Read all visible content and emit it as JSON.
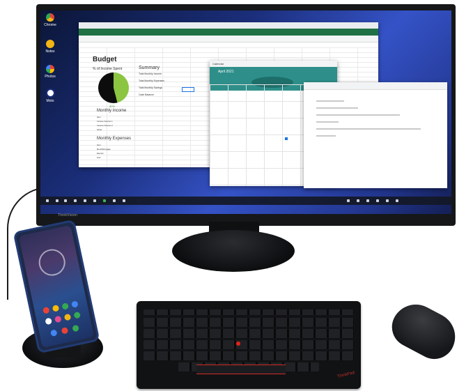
{
  "monitor": {
    "brand": "ThinkVision",
    "desktop_icons": [
      {
        "label": "Chrome",
        "color": "#e0453a"
      },
      {
        "label": "Notes",
        "color": "#f1b514"
      },
      {
        "label": "Photos",
        "color": "#ffffff"
      },
      {
        "label": "Moto",
        "color": "#1b2e7a"
      }
    ],
    "sheets": {
      "title": "Budget",
      "pie_label": "% of Income Spent",
      "pie_percent": "80%",
      "summary_title": "Summary",
      "summary_lines": [
        "Total Monthly Income",
        "Total Monthly Expenses",
        "Total Monthly Savings",
        "Cash Balance"
      ],
      "income_title": "Monthly Income",
      "income_rows": [
        "Item",
        "Income Source 1",
        "Income Source 2",
        "Other"
      ],
      "expenses_title": "Monthly Expenses",
      "expense_rows": [
        "Item",
        "Rent/Mortgage",
        "Electric",
        "Gas"
      ]
    },
    "calendar": {
      "title": "Calendar",
      "month": "April 2021"
    }
  },
  "keyboard": {
    "brand": "ThinkPad"
  },
  "colors": {
    "sheets_green": "#207245",
    "calendar_teal": "#2e8f8a",
    "trackpoint_red": "#e2231a"
  }
}
